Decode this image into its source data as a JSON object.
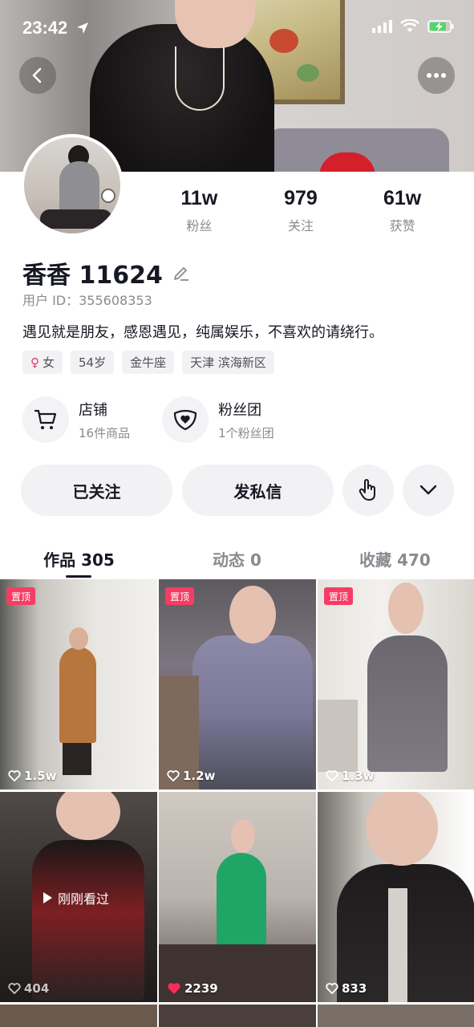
{
  "status_bar": {
    "time": "23:42"
  },
  "profile": {
    "name": "香香 11624",
    "user_id": "用户 ID：355608353",
    "bio": "遇见就是朋友，感恩遇见，纯属娱乐，不喜欢的请绕行。",
    "stats": [
      {
        "value": "11w",
        "label": "粉丝"
      },
      {
        "value": "979",
        "label": "关注"
      },
      {
        "value": "61w",
        "label": "获赞"
      }
    ],
    "tags": {
      "gender": "女",
      "age": "54岁",
      "zodiac": "金牛座",
      "location": "天津 滨海新区"
    }
  },
  "shortcuts": [
    {
      "title": "店铺",
      "subtitle": "16件商品",
      "icon": "cart-icon"
    },
    {
      "title": "粉丝团",
      "subtitle": "1个粉丝团",
      "icon": "heart-badge-icon"
    }
  ],
  "actions": {
    "follow_label": "已关注",
    "message_label": "发私信"
  },
  "tabs": [
    {
      "label": "作品 305"
    },
    {
      "label": "动态 0"
    },
    {
      "label": "收藏 470"
    }
  ],
  "grid": {
    "pin_label": "置顶",
    "seen_label": "刚刚看过",
    "items": [
      {
        "likes": "1.5w",
        "pinned": true
      },
      {
        "likes": "1.2w",
        "pinned": true
      },
      {
        "likes": "1.3w",
        "pinned": true
      },
      {
        "likes": "404"
      },
      {
        "likes": "2239",
        "liked": true
      },
      {
        "likes": "833"
      }
    ]
  },
  "colors": {
    "accent_red": "#f53d63",
    "like_red": "#fe2c55",
    "text_primary": "#161823",
    "text_secondary": "#8a8b91"
  }
}
